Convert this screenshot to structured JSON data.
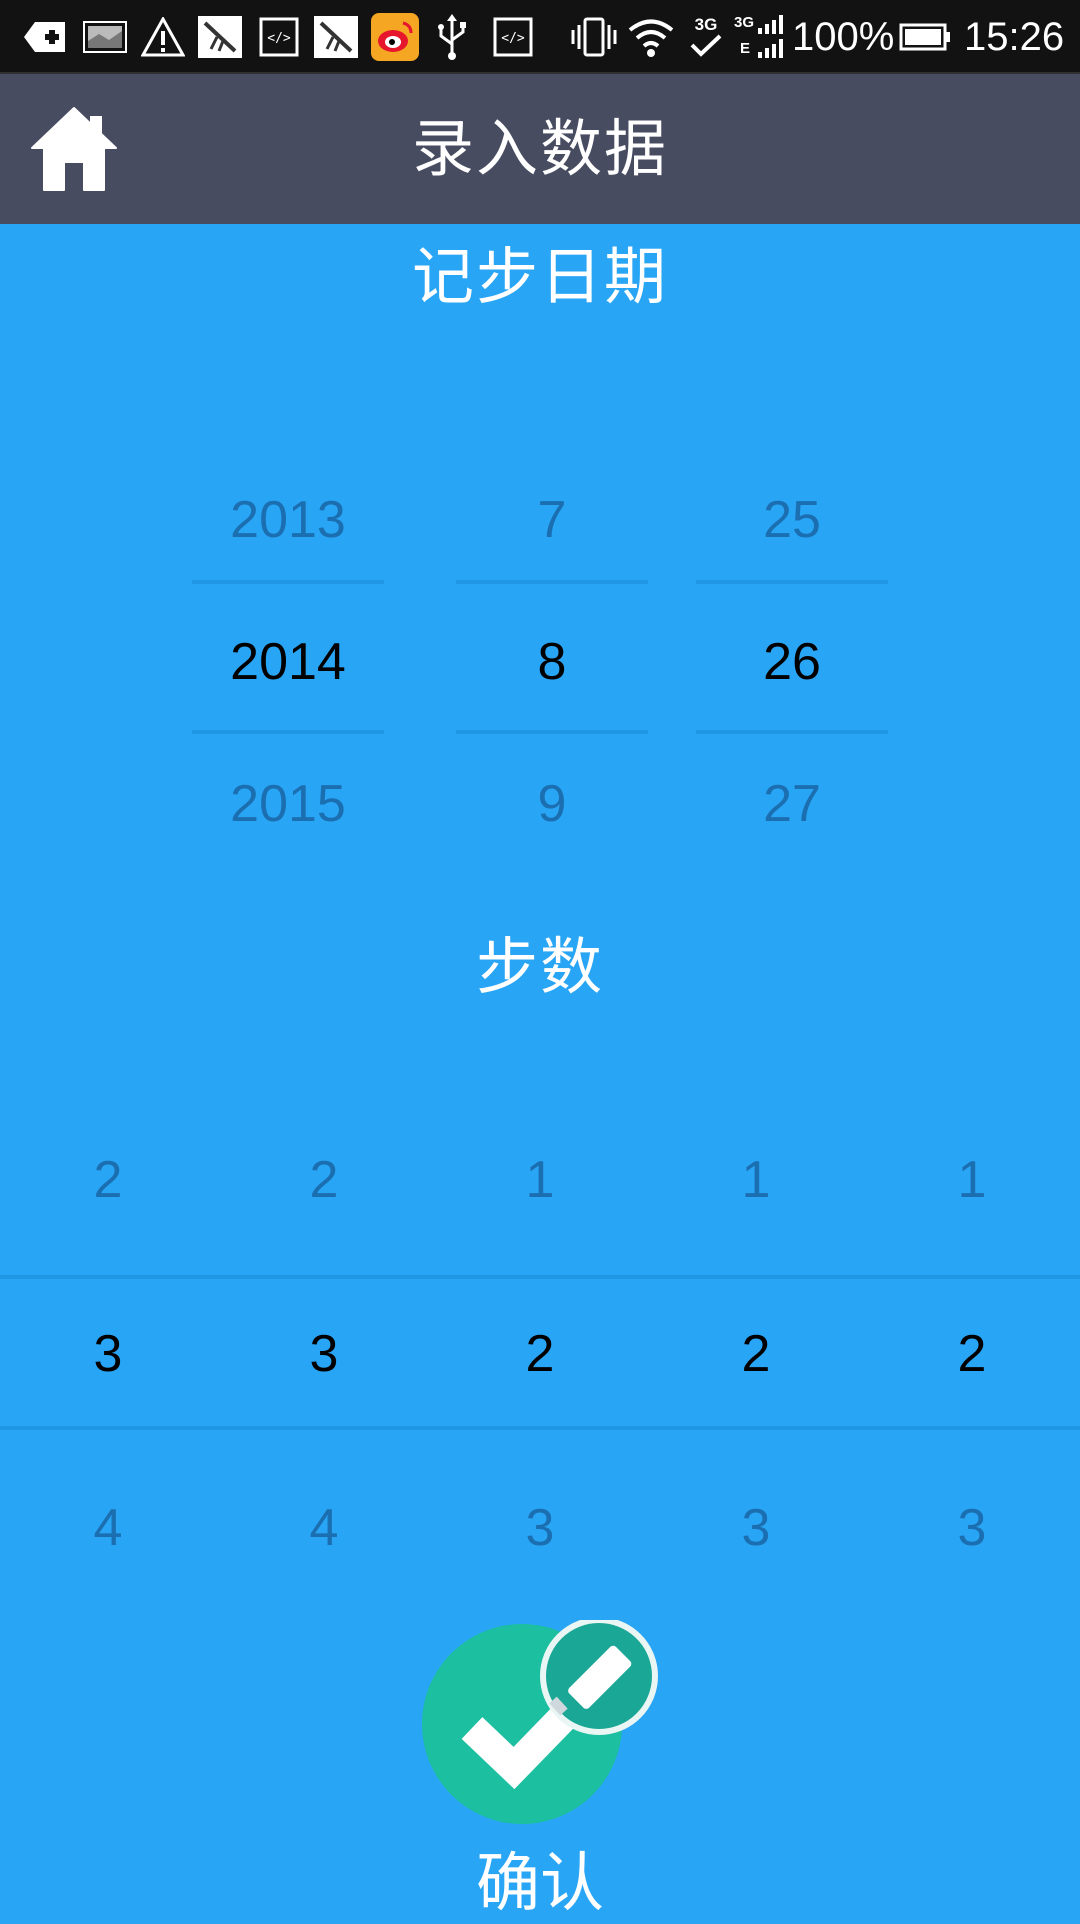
{
  "status_bar": {
    "battery": "100%",
    "time": "15:26",
    "network_top": "3G",
    "network_bottom": "3G",
    "network_e": "E",
    "icons": [
      "add-notification-icon",
      "image-icon",
      "warning-icon",
      "app-icon",
      "code-icon",
      "app-icon",
      "weibo-icon",
      "usb-icon",
      "code-icon",
      "vibrate-icon",
      "wifi-icon",
      "signal-icon",
      "battery-icon"
    ]
  },
  "header": {
    "title": "录入数据",
    "home_icon": "home-icon"
  },
  "date_section": {
    "label": "记步日期",
    "year": {
      "prev": "2013",
      "selected": "2014",
      "next": "2015"
    },
    "month": {
      "prev": "7",
      "selected": "8",
      "next": "9"
    },
    "day": {
      "prev": "25",
      "selected": "26",
      "next": "27"
    }
  },
  "steps_section": {
    "label": "步数",
    "digits": [
      {
        "prev": "2",
        "selected": "3",
        "next": "4"
      },
      {
        "prev": "2",
        "selected": "3",
        "next": "4"
      },
      {
        "prev": "1",
        "selected": "2",
        "next": "3"
      },
      {
        "prev": "1",
        "selected": "2",
        "next": "3"
      },
      {
        "prev": "1",
        "selected": "2",
        "next": "3"
      }
    ]
  },
  "confirm": {
    "label": "确认",
    "icon": "check-edit-icon"
  },
  "colors": {
    "background": "#29a5f6",
    "title_bar": "#474c61",
    "confirm_green": "#1cbf9f",
    "faded_text": "#1b6fb0"
  }
}
